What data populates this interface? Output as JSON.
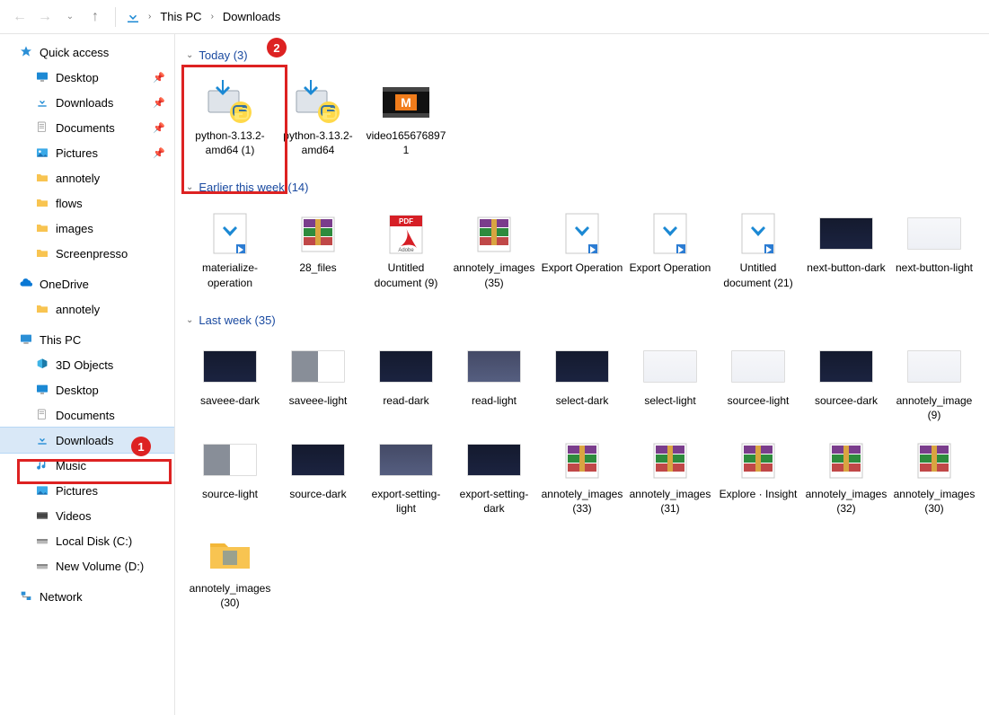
{
  "breadcrumb": {
    "root": "This PC",
    "current": "Downloads"
  },
  "nav": {
    "quick_access": "Quick access",
    "desktop": "Desktop",
    "downloads": "Downloads",
    "documents": "Documents",
    "pictures": "Pictures",
    "annotely": "annotely",
    "flows": "flows",
    "images": "images",
    "screenpresso": "Screenpresso",
    "onedrive": "OneDrive",
    "od_annotely": "annotely",
    "thispc": "This PC",
    "3d": "3D Objects",
    "pc_desktop": "Desktop",
    "pc_documents": "Documents",
    "pc_downloads": "Downloads",
    "pc_music": "Music",
    "pc_pictures": "Pictures",
    "pc_videos": "Videos",
    "localdisk": "Local Disk (C:)",
    "newvol": "New Volume (D:)",
    "network": "Network"
  },
  "groups": {
    "today": {
      "label": "Today (3)",
      "items": [
        {
          "name": "python-3.13.2-amd64 (1)",
          "icon": "python-installer"
        },
        {
          "name": "python-3.13.2-amd64",
          "icon": "python-installer"
        },
        {
          "name": "video1656768971",
          "icon": "video-m"
        }
      ]
    },
    "earlier": {
      "label": "Earlier this week (14)",
      "items": [
        {
          "name": "materialize-operation",
          "icon": "download-vs"
        },
        {
          "name": "28_files",
          "icon": "archive"
        },
        {
          "name": "Untitled document (9)",
          "icon": "pdf"
        },
        {
          "name": "annotely_images (35)",
          "icon": "archive"
        },
        {
          "name": "Export Operation",
          "icon": "download-vs"
        },
        {
          "name": "Export Operation",
          "icon": "download-vs"
        },
        {
          "name": "Untitled document (21)",
          "icon": "download-vs"
        },
        {
          "name": "next-button-dark",
          "icon": "thumb-dark"
        },
        {
          "name": "next-button-light",
          "icon": "thumb-light"
        }
      ]
    },
    "lastweek": {
      "label": "Last week (35)",
      "items": [
        {
          "name": "saveee-dark",
          "icon": "thumb-dark"
        },
        {
          "name": "saveee-light",
          "icon": "thumb-split"
        },
        {
          "name": "read-dark",
          "icon": "thumb-dark"
        },
        {
          "name": "read-light",
          "icon": "thumb-med"
        },
        {
          "name": "select-dark",
          "icon": "thumb-dark"
        },
        {
          "name": "select-light",
          "icon": "thumb-light"
        },
        {
          "name": "sourcee-light",
          "icon": "thumb-light"
        },
        {
          "name": "sourcee-dark",
          "icon": "thumb-dark"
        },
        {
          "name": "annotely_image (9)",
          "icon": "thumb-light"
        },
        {
          "name": "source-light",
          "icon": "thumb-split"
        },
        {
          "name": "source-dark",
          "icon": "thumb-dark"
        },
        {
          "name": "export-setting-light",
          "icon": "thumb-med"
        },
        {
          "name": "export-setting-dark",
          "icon": "thumb-dark"
        },
        {
          "name": "annotely_images (33)",
          "icon": "archive"
        },
        {
          "name": "annotely_images (31)",
          "icon": "archive"
        },
        {
          "name": "Explore · Insight",
          "icon": "archive"
        },
        {
          "name": "annotely_images (32)",
          "icon": "archive"
        },
        {
          "name": "annotely_images (30)",
          "icon": "archive"
        },
        {
          "name": "annotely_images (30)",
          "icon": "folder"
        }
      ]
    }
  },
  "annotations": {
    "one": "1",
    "two": "2"
  }
}
